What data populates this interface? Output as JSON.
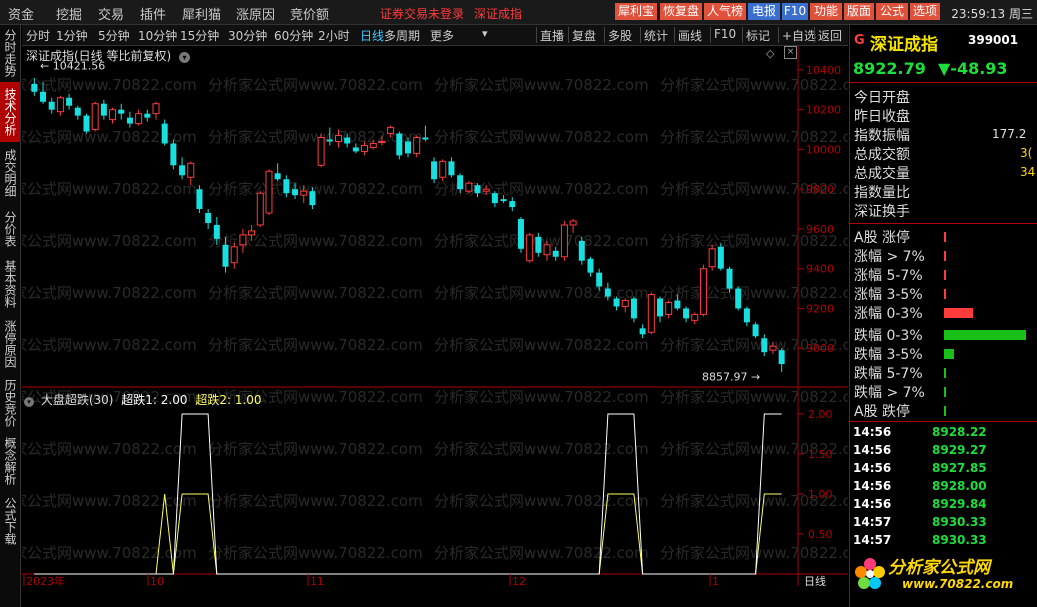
{
  "menu": {
    "items": [
      "资金",
      "挖掘",
      "交易",
      "插件",
      "犀利猫",
      "涨原因",
      "竞价额"
    ],
    "warning": "证券交易未登录",
    "warning_link": "深证成指"
  },
  "toolbar_buttons": [
    {
      "label": "犀利宝",
      "bg": "#e0513c"
    },
    {
      "label": "恢复盘",
      "bg": "#e0513c"
    },
    {
      "label": "人气榜",
      "bg": "#e0513c"
    },
    {
      "label": "电报",
      "bg": "#3a6fd0"
    },
    {
      "label": "F10",
      "bg": "#3a6fd0"
    },
    {
      "label": "功能",
      "bg": "#e0513c"
    },
    {
      "label": "版面",
      "bg": "#e0513c"
    },
    {
      "label": "公式",
      "bg": "#e0513c"
    },
    {
      "label": "选项",
      "bg": "#e0513c"
    }
  ],
  "clock": "23:59:13 周三",
  "periods": [
    "分时",
    "1分钟",
    "5分钟",
    "10分钟",
    "15分钟",
    "30分钟",
    "60分钟",
    "2小时",
    "日线",
    "多周期",
    "更多"
  ],
  "active_period": "日线",
  "right_tools": [
    "直播",
    "复盘",
    "多股",
    "统计",
    "画线",
    "F10",
    "标记",
    "+自选",
    "返回"
  ],
  "left_tabs": [
    "分时走势",
    "技术分析",
    "成交明细",
    "分价表",
    "基本资料",
    "涨停原因",
    "历史竞价",
    "概念解析",
    "公式下载"
  ],
  "chart": {
    "title": "深证成指(日线 等比前复权)",
    "high_label": "10421.56",
    "low_label": "8857.97",
    "y_ticks": [
      "10400",
      "10200",
      "10000",
      "9800",
      "9600",
      "9400",
      "9200",
      "9000"
    ],
    "watermark": "分析家公式网www.70822.com",
    "x_labels": [
      "2023年",
      "10",
      "11",
      "12",
      "1"
    ],
    "x_right": "日线"
  },
  "indicator": {
    "name": "大盘超跌(30)",
    "line1": "超跌1: 2.00",
    "line2": "超跌2: 1.00",
    "y_ticks": [
      "2.00",
      "1.50",
      "1.00",
      "0.50"
    ]
  },
  "quote": {
    "badge": "G",
    "name": "深证成指",
    "code": "399001",
    "price": "8922.79",
    "change": "▼-48.93",
    "fields": [
      "今日开盘",
      "昨日收盘",
      "指数振幅",
      "总成交额",
      "总成交量",
      "指数量比",
      "深证换手"
    ],
    "field_values": [
      "",
      "",
      "177.2",
      "3(",
      "34",
      "",
      ""
    ],
    "breadth_up": [
      "A股 涨停",
      "涨幅 > 7%",
      "涨幅 5-7%",
      "涨幅 3-5%",
      "涨幅 0-3%"
    ],
    "breadth_down": [
      "跌幅 0-3%",
      "跌幅 3-5%",
      "跌幅 5-7%",
      "跌幅 > 7%",
      "A股 跌停"
    ],
    "up_bars": [
      0.01,
      0.01,
      0.01,
      0.03,
      0.35
    ],
    "down_bars": [
      1.0,
      0.12,
      0.02,
      0.01,
      0.01
    ]
  },
  "ticks": [
    {
      "time": "14:56",
      "value": "8928.22"
    },
    {
      "time": "14:56",
      "value": "8929.27"
    },
    {
      "time": "14:56",
      "value": "8927.85"
    },
    {
      "time": "14:56",
      "value": "8928.00"
    },
    {
      "time": "14:56",
      "value": "8929.84"
    },
    {
      "time": "14:57",
      "value": "8930.33"
    },
    {
      "time": "14:57",
      "value": "8930.33"
    }
  ],
  "logo": {
    "text": "分析家公式网",
    "url": "www.70822.com"
  },
  "colors": {
    "up": "#ff3b3b",
    "down": "#18e0e0",
    "axis": "#b00000",
    "line1": "#ffffff",
    "line2": "#ffff66"
  },
  "chart_data": {
    "type": "candlestick",
    "series": [
      {
        "name": "",
        "ohlc": [
          [
            10330,
            10360,
            10270,
            10290
          ],
          [
            10290,
            10340,
            10230,
            10240
          ],
          [
            10240,
            10260,
            10180,
            10200
          ],
          [
            10190,
            10270,
            10170,
            10260
          ],
          [
            10260,
            10280,
            10200,
            10220
          ],
          [
            10210,
            10220,
            10150,
            10170
          ],
          [
            10170,
            10180,
            10080,
            10090
          ],
          [
            10100,
            10240,
            10090,
            10230
          ],
          [
            10230,
            10250,
            10150,
            10170
          ],
          [
            10150,
            10210,
            10130,
            10200
          ],
          [
            10200,
            10230,
            10150,
            10180
          ],
          [
            10160,
            10190,
            10110,
            10130
          ],
          [
            10130,
            10200,
            10120,
            10180
          ],
          [
            10180,
            10200,
            10140,
            10160
          ],
          [
            10180,
            10240,
            10150,
            10230
          ],
          [
            10130,
            10150,
            10020,
            10030
          ],
          [
            10030,
            10050,
            9900,
            9920
          ],
          [
            9920,
            9960,
            9850,
            9870
          ],
          [
            9860,
            9940,
            9820,
            9930
          ],
          [
            9800,
            9820,
            9680,
            9700
          ],
          [
            9680,
            9700,
            9600,
            9630
          ],
          [
            9620,
            9660,
            9520,
            9550
          ],
          [
            9520,
            9560,
            9380,
            9410
          ],
          [
            9430,
            9530,
            9400,
            9510
          ],
          [
            9520,
            9600,
            9480,
            9570
          ],
          [
            9570,
            9620,
            9540,
            9590
          ],
          [
            9620,
            9790,
            9610,
            9780
          ],
          [
            9680,
            9900,
            9670,
            9890
          ],
          [
            9880,
            9930,
            9840,
            9850
          ],
          [
            9850,
            9870,
            9760,
            9780
          ],
          [
            9800,
            9830,
            9750,
            9770
          ],
          [
            9770,
            9820,
            9730,
            9790
          ],
          [
            9790,
            9810,
            9700,
            9720
          ],
          [
            9920,
            10080,
            9910,
            10060
          ],
          [
            10050,
            10110,
            10020,
            10040
          ],
          [
            10040,
            10100,
            10010,
            10070
          ],
          [
            10060,
            10080,
            10010,
            10030
          ],
          [
            10010,
            10030,
            9980,
            9990
          ],
          [
            9990,
            10040,
            9970,
            10020
          ],
          [
            10010,
            10050,
            10000,
            10030
          ],
          [
            10040,
            10070,
            10020,
            10040
          ],
          [
            10080,
            10120,
            10060,
            10110
          ],
          [
            10080,
            10090,
            9950,
            9970
          ],
          [
            10040,
            10060,
            9960,
            9980
          ],
          [
            9980,
            10070,
            9960,
            10060
          ],
          [
            10060,
            10120,
            10040,
            10050
          ],
          [
            9940,
            9960,
            9830,
            9850
          ],
          [
            9860,
            9950,
            9840,
            9940
          ],
          [
            9940,
            9960,
            9860,
            9870
          ],
          [
            9870,
            9880,
            9780,
            9800
          ],
          [
            9790,
            9840,
            9780,
            9830
          ],
          [
            9820,
            9830,
            9760,
            9780
          ],
          [
            9790,
            9820,
            9770,
            9800
          ],
          [
            9780,
            9790,
            9710,
            9730
          ],
          [
            9750,
            9770,
            9730,
            9740
          ],
          [
            9740,
            9760,
            9690,
            9710
          ],
          [
            9650,
            9660,
            9480,
            9500
          ],
          [
            9440,
            9580,
            9430,
            9570
          ],
          [
            9560,
            9580,
            9460,
            9480
          ],
          [
            9470,
            9540,
            9440,
            9520
          ],
          [
            9490,
            9510,
            9440,
            9460
          ],
          [
            9460,
            9640,
            9440,
            9620
          ],
          [
            9620,
            9650,
            9580,
            9640
          ],
          [
            9540,
            9560,
            9420,
            9440
          ],
          [
            9450,
            9460,
            9360,
            9380
          ],
          [
            9380,
            9400,
            9290,
            9310
          ],
          [
            9300,
            9330,
            9240,
            9260
          ],
          [
            9250,
            9260,
            9190,
            9210
          ],
          [
            9210,
            9250,
            9180,
            9240
          ],
          [
            9250,
            9260,
            9130,
            9150
          ],
          [
            9100,
            9120,
            9050,
            9070
          ],
          [
            9080,
            9280,
            9070,
            9270
          ],
          [
            9250,
            9260,
            9130,
            9160
          ],
          [
            9170,
            9240,
            9150,
            9230
          ],
          [
            9240,
            9270,
            9190,
            9200
          ],
          [
            9200,
            9210,
            9130,
            9150
          ],
          [
            9140,
            9180,
            9120,
            9170
          ],
          [
            9170,
            9420,
            9160,
            9400
          ],
          [
            9410,
            9520,
            9390,
            9500
          ],
          [
            9510,
            9530,
            9390,
            9400
          ],
          [
            9400,
            9410,
            9280,
            9300
          ],
          [
            9300,
            9310,
            9190,
            9200
          ],
          [
            9200,
            9210,
            9110,
            9130
          ],
          [
            9120,
            9130,
            9050,
            9060
          ],
          [
            9050,
            9070,
            8960,
            8980
          ],
          [
            8990,
            9030,
            8970,
            9010
          ],
          [
            8990,
            9000,
            8880,
            8920
          ]
        ]
      }
    ],
    "ylim": [
      8850,
      10460
    ],
    "indicator_series": [
      {
        "name": "超跌1",
        "ylim": [
          0,
          2.2
        ]
      },
      {
        "name": "超跌2",
        "ylim": [
          0,
          2.2
        ]
      }
    ]
  }
}
